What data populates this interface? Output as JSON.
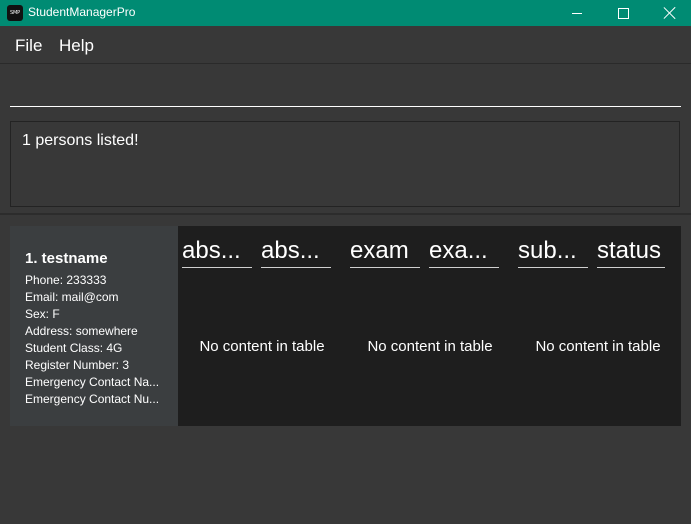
{
  "window": {
    "title": "StudentManagerPro",
    "icon_label": "SMP",
    "accent_color": "#008b73"
  },
  "menu": {
    "items": [
      {
        "label": "File"
      },
      {
        "label": "Help"
      }
    ]
  },
  "command": {
    "value": "",
    "placeholder": ""
  },
  "result": {
    "message": "1 persons listed!"
  },
  "person": {
    "index_name": "1.  testname",
    "fields": [
      "Phone: 233333",
      "Email: mail@com",
      "Sex: F",
      "Address: somewhere",
      "Student Class: 4G",
      "Register Number: 3",
      "Emergency Contact Na...",
      "Emergency Contact Nu..."
    ],
    "tables": [
      {
        "headers": [
          "abs...",
          "abs..."
        ],
        "empty_text": "No content in table"
      },
      {
        "headers": [
          "exam",
          "exa..."
        ],
        "empty_text": "No content in table"
      },
      {
        "headers": [
          "sub...",
          "status"
        ],
        "empty_text": "No content in table"
      }
    ]
  }
}
